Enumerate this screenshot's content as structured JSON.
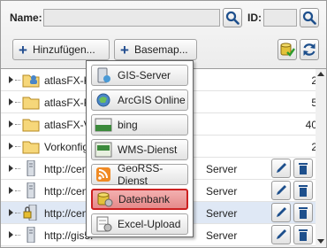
{
  "search": {
    "name_label": "Name:",
    "name_value": "",
    "id_label": "ID:",
    "id_value": ""
  },
  "toolbar": {
    "add_label": "Hinzufügen...",
    "basemap_label": "Basemap..."
  },
  "dropdown": {
    "items": [
      {
        "label": "GIS-Server",
        "icon": "gis-server-icon"
      },
      {
        "label": "ArcGIS Online",
        "icon": "arcgis-online-icon"
      },
      {
        "label": "bing",
        "icon": "bing-icon"
      },
      {
        "label": "WMS-Dienst",
        "icon": "wms-icon"
      },
      {
        "label": "GeoRSS-Dienst",
        "icon": "georss-icon"
      },
      {
        "label": "Datenbank",
        "icon": "database-icon",
        "highlighted": true
      },
      {
        "label": "Excel-Upload",
        "icon": "excel-icon"
      }
    ]
  },
  "list": {
    "rows": [
      {
        "text": "atlasFX-Ka",
        "suffix": "",
        "count": "2",
        "icon": "folder-user-icon"
      },
      {
        "text": "atlasFX-Ra",
        "suffix": "",
        "count": "5",
        "icon": "folder-icon"
      },
      {
        "text": "atlasFX-V",
        "suffix": "",
        "count": "40",
        "icon": "folder-icon"
      },
      {
        "text": "Vorkonfig",
        "suffix": "",
        "count": "2",
        "icon": "folder-icon"
      },
      {
        "text": "http://centr",
        "suffix": "Server",
        "count": "",
        "icon": "server-icon"
      },
      {
        "text": "http://centr",
        "suffix": "Server",
        "count": "",
        "icon": "server-icon"
      },
      {
        "text": "http://centr",
        "suffix": "Server",
        "count": "",
        "icon": "server-lock-icon",
        "selected": true
      },
      {
        "text": "http://gis5.",
        "suffix": "Server",
        "count": "",
        "icon": "server-icon"
      }
    ]
  },
  "colors": {
    "accent": "#224d8f",
    "highlight": "#e58a8a",
    "selected_row": "#dfe8f5"
  }
}
